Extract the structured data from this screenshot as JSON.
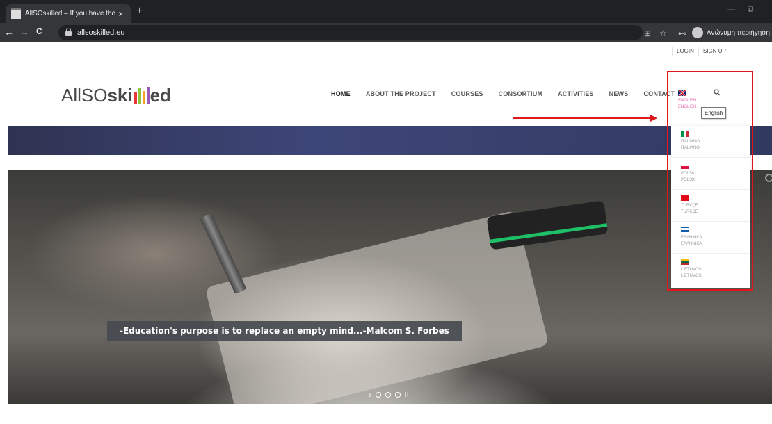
{
  "browser": {
    "tab_title": "AllSOskilled – If you have the skill",
    "tab_close": "×",
    "new_tab": "+",
    "url": "allsoskilled.eu",
    "back": "←",
    "forward": "→",
    "reload": "C",
    "translate_icon": "⊞",
    "star_icon": "☆",
    "key_icon": "⊷",
    "incognito_label": "Ανώνυμη περιήγηση",
    "min": "—",
    "restore": "⧉"
  },
  "toplinks": [
    "LOGIN",
    "SIGN UP"
  ],
  "logo": {
    "part_a": "AllSO",
    "part_b_start": "ski",
    "part_b_end": "ed",
    "bar_colors": [
      "#e8373a",
      "#8cc63f",
      "#f4a321",
      "#9b59b6"
    ]
  },
  "nav": [
    "HOME",
    "ABOUT THE PROJECT",
    "COURSES",
    "CONSORTIUM",
    "ACTIVITIES",
    "NEWS",
    "CONTACT"
  ],
  "search_icon": "search-icon",
  "lang_current": {
    "line1": "ENGLISH",
    "line2": "ENGLISH"
  },
  "tooltip": "English",
  "languages": [
    {
      "line1": "ITALIANO",
      "line2": "ITALIANO",
      "flag": "it"
    },
    {
      "line1": "POLSKI",
      "line2": "POLSKI",
      "flag": "pl"
    },
    {
      "line1": "TÜRKÇE",
      "line2": "TÜRKÇE",
      "flag": "tr"
    },
    {
      "line1": "ΕΛΛΗΝΙΚΑ",
      "line2": "ΕΛΛΗΝΙΚΑ",
      "flag": "gr"
    },
    {
      "line1": "LIETUVOS",
      "line2": "LIETUVOS",
      "flag": "lt"
    }
  ],
  "slider": {
    "caption": "-Education's purpose is to replace an empty mind...-Malcom S. Forbes",
    "next": "›",
    "pause": "II",
    "dots": 3
  },
  "colors": {
    "annotation": "#e0161b",
    "accent_pink": "#e86ab3"
  }
}
